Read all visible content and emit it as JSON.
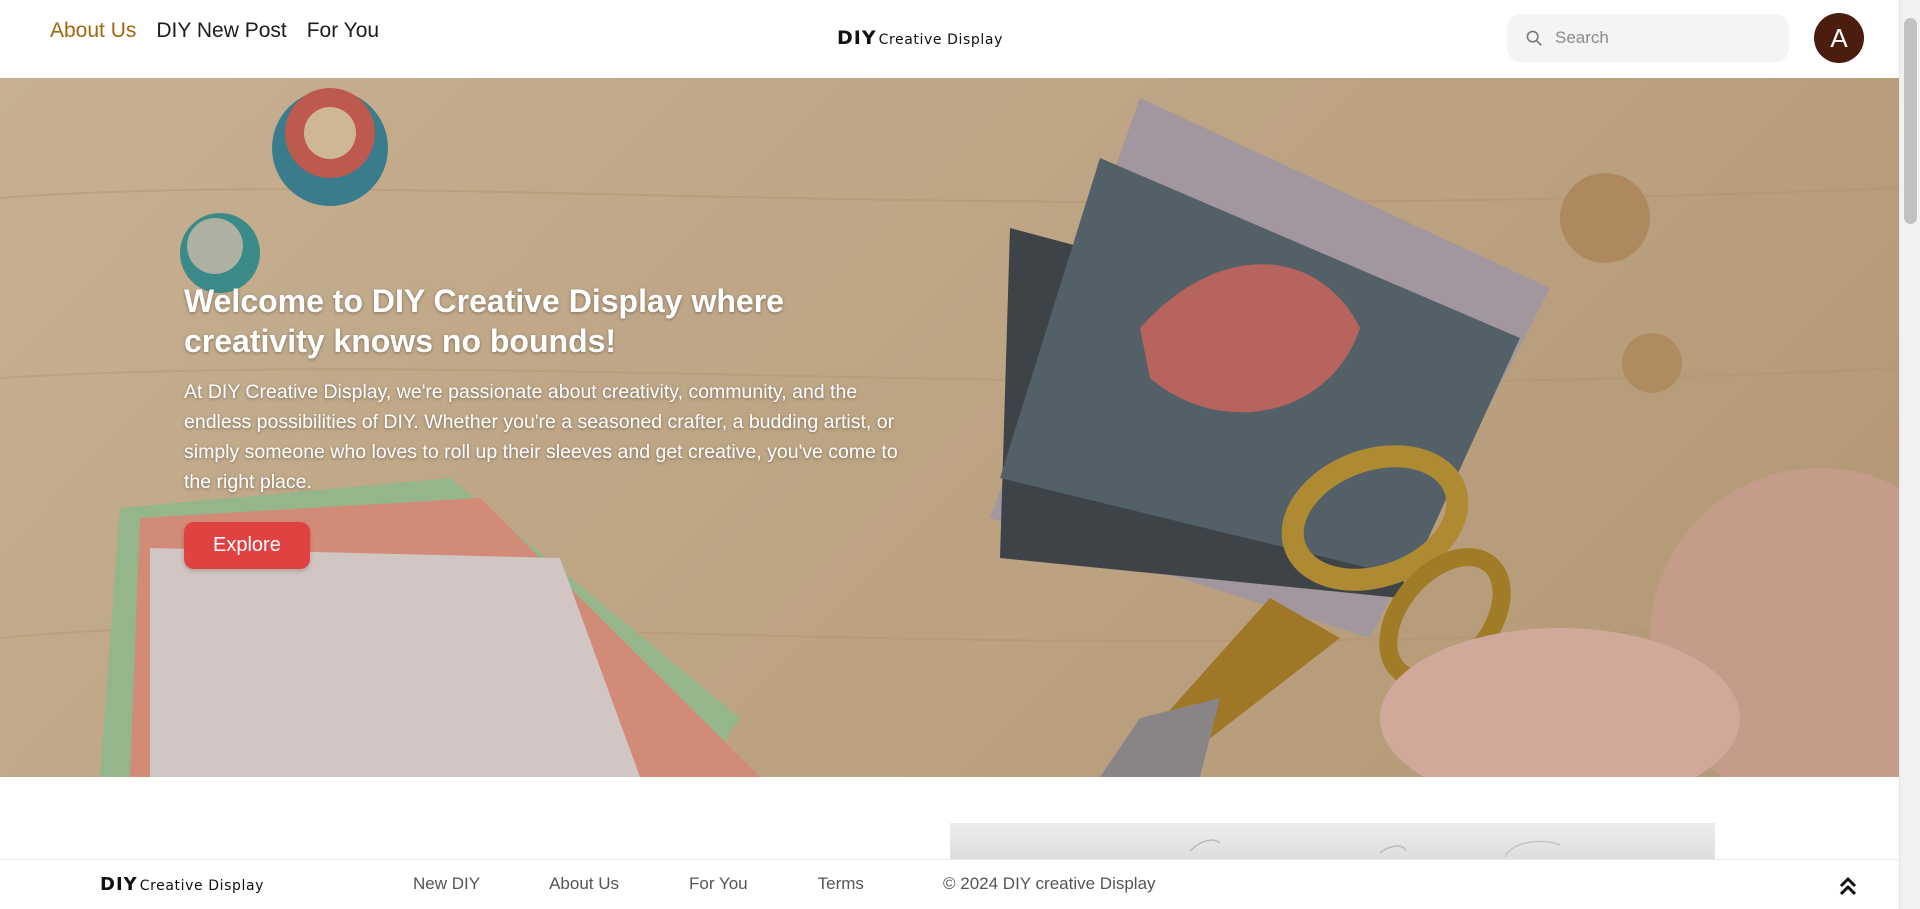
{
  "header": {
    "nav": [
      "About Us",
      "DIY New Post",
      "For You"
    ],
    "active_nav": "About Us",
    "brand_main": "DIY",
    "brand_sub": "Creative Display",
    "search_placeholder": "Search",
    "avatar_letter": "A"
  },
  "hero": {
    "title": "Welcome to DIY Creative Display where creativity knows no bounds!",
    "body": "At DIY Creative Display, we're passionate about creativity, community, and the endless possibilities of DIY. Whether you're a seasoned crafter, a budding artist, or simply someone who loves to roll up their sleeves and get creative, you've come to the right place.",
    "cta_label": "Explore"
  },
  "footer": {
    "brand_main": "DIY",
    "brand_sub": "Creative Display",
    "links": [
      "New DIY",
      "About Us",
      "For You",
      "Terms"
    ],
    "copyright": "© 2024 DIY creative Display"
  },
  "colors": {
    "accent": "#a4650f",
    "cta": "#e04242",
    "avatar": "#4a1d0f"
  }
}
